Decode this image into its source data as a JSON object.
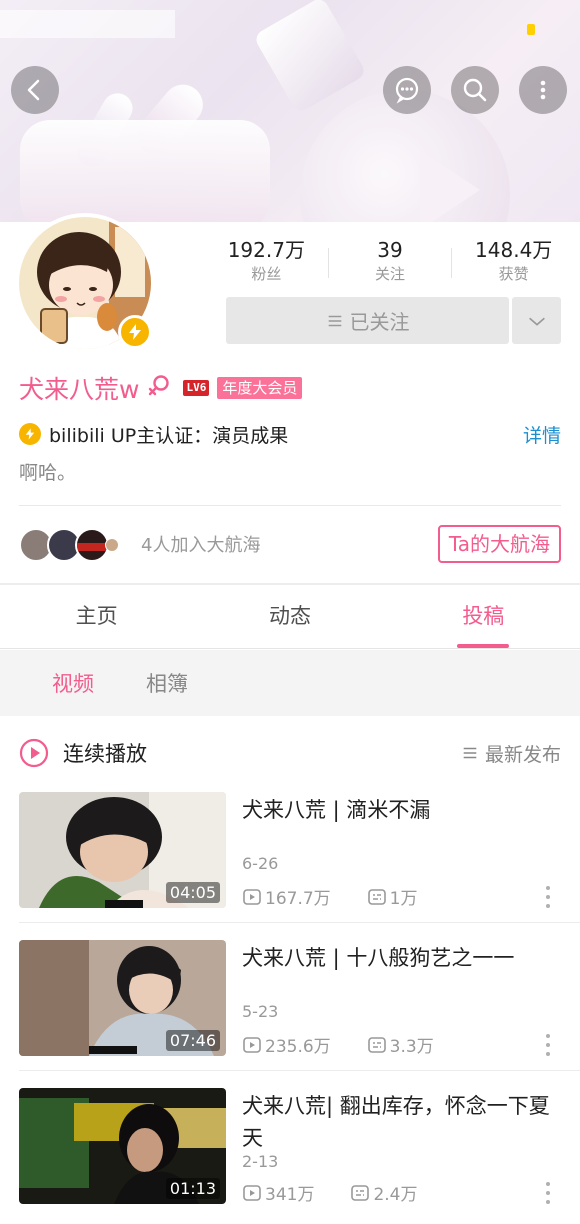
{
  "profile": {
    "stats": [
      {
        "num": "192.7万",
        "label": "粉丝"
      },
      {
        "num": "39",
        "label": "关注"
      },
      {
        "num": "148.4万",
        "label": "获赞"
      }
    ],
    "follow_label": "已关注",
    "name": "犬来八荒w",
    "level": "LV6",
    "vip": "年度大会员",
    "cert": "bilibili UP主认证：演员成果",
    "cert_detail": "详情",
    "bio": "啊哈。",
    "fleet_text": "4人加入大航海",
    "fleet_button": "Ta的大航海"
  },
  "tabs": [
    "主页",
    "动态",
    "投稿"
  ],
  "subtabs": [
    "视频",
    "相簿"
  ],
  "playlist": {
    "label": "连续播放",
    "sort": "最新发布"
  },
  "videos": [
    {
      "title": "犬来八荒 | 滴米不漏",
      "duration": "04:05",
      "date": "6-26",
      "plays": "167.7万",
      "danmaku": "1万"
    },
    {
      "title": "犬来八荒 | 十八般狗艺之一一",
      "duration": "07:46",
      "date": "5-23",
      "plays": "235.6万",
      "danmaku": "3.3万"
    },
    {
      "title": "犬来八荒| 翻出库存，怀念一下夏天",
      "duration": "01:13",
      "date": "2-13",
      "plays": "341万",
      "danmaku": "2.4万"
    }
  ],
  "colors": {
    "accent": "#f25d8e",
    "link": "#1c8fcf",
    "vip": "#fb7299",
    "badge": "#f7b500"
  }
}
